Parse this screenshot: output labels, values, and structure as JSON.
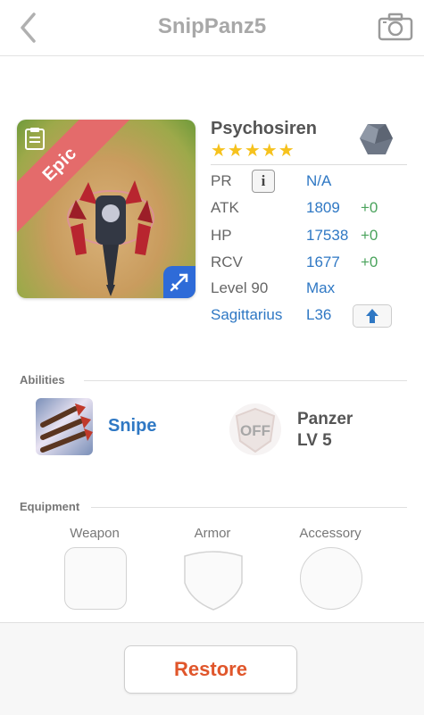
{
  "header": {
    "title": "SnipPanz5",
    "back_icon": "chevron-left-icon",
    "camera_icon": "camera-icon"
  },
  "monster": {
    "rarity": "Epic",
    "name": "Psychosiren",
    "stars": "★★★★★",
    "star_count": 5,
    "element_icon": "rock-gem-icon",
    "role_icon": "sniper-role-icon"
  },
  "stats": {
    "pr": {
      "label": "PR",
      "value": "N/A"
    },
    "atk": {
      "label": "ATK",
      "value": "1809",
      "bonus": "+0"
    },
    "hp": {
      "label": "HP",
      "value": "17538",
      "bonus": "+0"
    },
    "rcv": {
      "label": "RCV",
      "value": "1677",
      "bonus": "+0"
    },
    "level": {
      "label": "Level 90",
      "value": "Max"
    },
    "sign": {
      "label": "Sagittarius",
      "value": "L36"
    }
  },
  "abilities": {
    "heading": "Abilities",
    "active": {
      "name": "Snipe"
    },
    "passive": {
      "badge": "OFF",
      "name_line1": "Panzer",
      "name_line2": "LV 5"
    }
  },
  "equipment": {
    "heading": "Equipment",
    "slots": [
      "Weapon",
      "Armor",
      "Accessory"
    ]
  },
  "footer": {
    "restore_label": "Restore"
  },
  "colors": {
    "accent_blue": "#2f78c4",
    "bonus_green": "#4aa35c",
    "restore_orange": "#e0562b",
    "epic_red": "#e46b6b",
    "star_gold": "#f6c21d"
  }
}
